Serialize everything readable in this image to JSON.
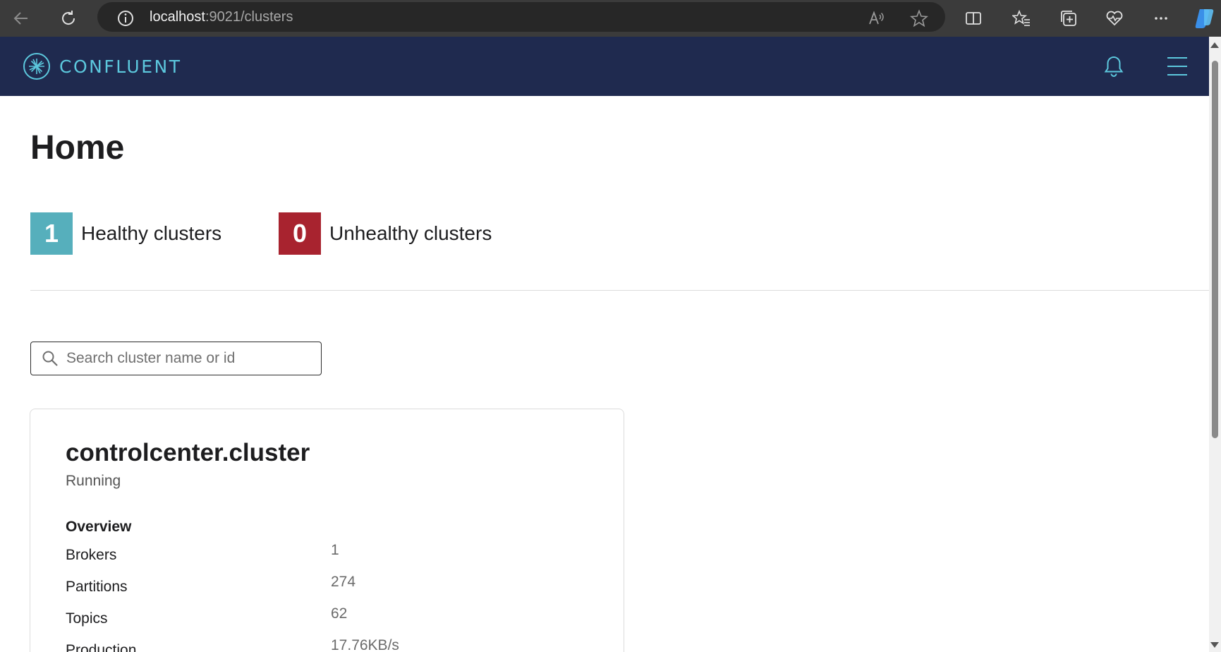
{
  "browser": {
    "url_host": "localhost",
    "url_path": ":9021/clusters"
  },
  "app": {
    "brand": "CONFLUENT"
  },
  "page": {
    "title": "Home"
  },
  "stats": {
    "healthy": {
      "count": "1",
      "label": "Healthy clusters",
      "color": "#56afbc"
    },
    "unhealthy": {
      "count": "0",
      "label": "Unhealthy clusters",
      "color": "#a8232f"
    }
  },
  "search": {
    "placeholder": "Search cluster name or id",
    "value": ""
  },
  "cluster": {
    "name": "controlcenter.cluster",
    "status": "Running",
    "overview_title": "Overview",
    "metrics": [
      {
        "label": "Brokers",
        "value": "1"
      },
      {
        "label": "Partitions",
        "value": "274"
      },
      {
        "label": "Topics",
        "value": "62"
      },
      {
        "label": "Production",
        "value": "17.76KB/s"
      }
    ]
  },
  "colors": {
    "browser_chrome": "#3b3b3b",
    "header_bg": "#1f2a4f",
    "brand_accent": "#5cc8dd"
  }
}
